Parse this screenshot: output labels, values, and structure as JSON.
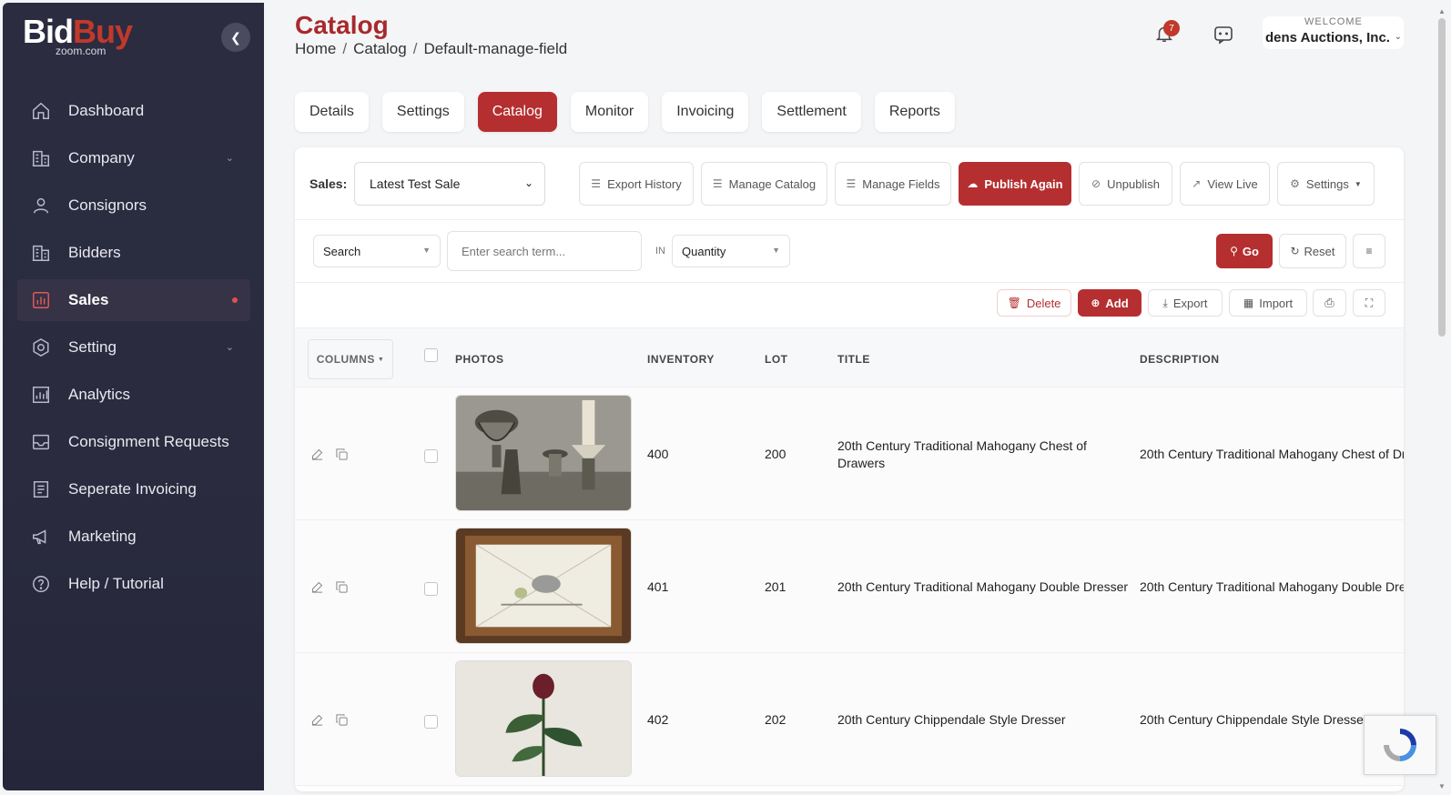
{
  "brand": {
    "logo_bid": "Bid",
    "logo_buy": "Buy",
    "logo_sub": "zoom.com",
    "accent": "#b52f30"
  },
  "sidebar": {
    "items": [
      {
        "label": "Dashboard",
        "icon": "home-icon"
      },
      {
        "label": "Company",
        "icon": "building-icon",
        "expandable": true
      },
      {
        "label": "Consignors",
        "icon": "user-icon"
      },
      {
        "label": "Bidders",
        "icon": "building-icon"
      },
      {
        "label": "Sales",
        "icon": "chart-icon",
        "active": true
      },
      {
        "label": "Setting",
        "icon": "gear-icon",
        "expandable": true
      },
      {
        "label": "Analytics",
        "icon": "analytics-icon"
      },
      {
        "label": "Consignment Requests",
        "icon": "inbox-icon"
      },
      {
        "label": "Seperate Invoicing",
        "icon": "document-icon"
      },
      {
        "label": "Marketing",
        "icon": "megaphone-icon"
      },
      {
        "label": "Help / Tutorial",
        "icon": "help-icon"
      }
    ]
  },
  "header": {
    "title": "Catalog",
    "breadcrumb": [
      "Home",
      "Catalog",
      "Default-manage-field"
    ],
    "notification_count": "7",
    "welcome_label": "WELCOME",
    "user_name": "dens Auctions, Inc."
  },
  "tabs": [
    "Details",
    "Settings",
    "Catalog",
    "Monitor",
    "Invoicing",
    "Settlement",
    "Reports"
  ],
  "active_tab": "Catalog",
  "toolbar": {
    "sales_label": "Sales:",
    "sales_value": "Latest Test Sale",
    "export_history": "Export History",
    "manage_catalog": "Manage Catalog",
    "manage_fields": "Manage Fields",
    "publish_again": "Publish Again",
    "unpublish": "Unpublish",
    "view_live": "View Live",
    "settings": "Settings"
  },
  "search": {
    "field_value": "Search",
    "placeholder": "Enter search term...",
    "in_label": "IN",
    "in_value": "Quantity",
    "go": "Go",
    "reset": "Reset"
  },
  "actions": {
    "delete": "Delete",
    "add": "Add",
    "export": "Export",
    "import": "Import"
  },
  "table": {
    "columns_btn": "COLUMNS",
    "headers": {
      "photos": "PHOTOS",
      "inventory": "INVENTORY",
      "lot": "LOT",
      "title": "TITLE",
      "description": "DESCRIPTION"
    },
    "rows": [
      {
        "inventory": "400",
        "lot": "200",
        "title": "20th Century Traditional Mahogany Chest of Drawers",
        "description": "20th Century Traditional Mahogany Chest of Dr"
      },
      {
        "inventory": "401",
        "lot": "201",
        "title": "20th Century Traditional Mahogany Double Dresser",
        "description": "20th Century Traditional Mahogany Double Dre"
      },
      {
        "inventory": "402",
        "lot": "202",
        "title": "20th Century Chippendale Style Dresser",
        "description": "20th Century Chippendale Style Dresser"
      }
    ]
  }
}
